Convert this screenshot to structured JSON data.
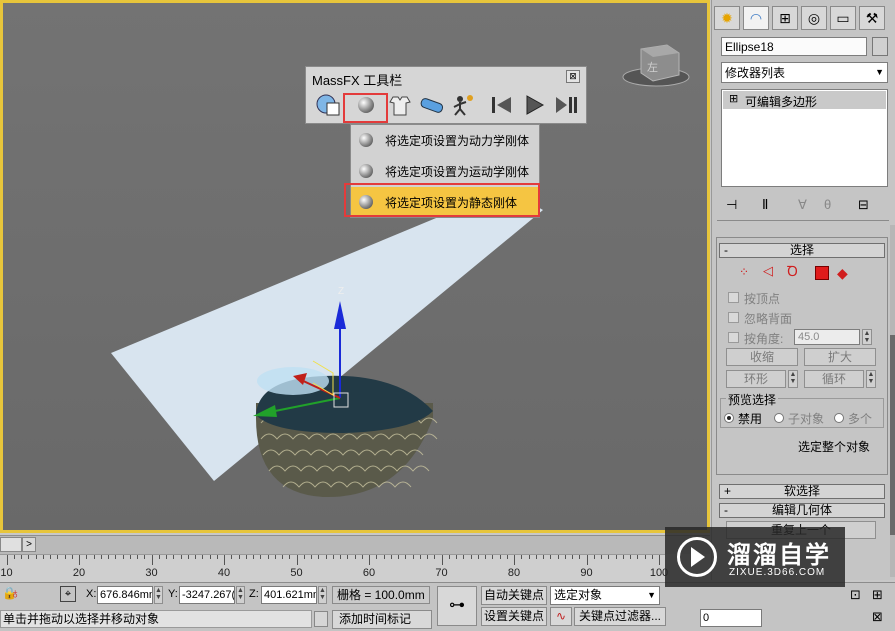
{
  "massfx_toolbar": {
    "title": "MassFX 工具栏",
    "close_symbol": "⊠",
    "dropdown_items": [
      {
        "label": "将选定项设置为动力学刚体",
        "highlighted": false
      },
      {
        "label": "将选定项设置为运动学刚体",
        "highlighted": false
      },
      {
        "label": "将选定项设置为静态刚体",
        "highlighted": true
      }
    ]
  },
  "viewport": {
    "axis_z": "Z",
    "viewcube_face": "左",
    "accent_border_color": "#e7c53b"
  },
  "command_panel": {
    "object_name": "Ellipse18",
    "modifier_list": "修改器列表",
    "stack_item": "可编辑多边形",
    "stack_item_toggle": "⊞",
    "selection_rollout": {
      "title": "选择",
      "sign": "-",
      "by_vertex": "按顶点",
      "ignore_backfacing": "忽略背面",
      "by_angle": "按角度:",
      "angle_value": "45.0",
      "shrink": "收缩",
      "grow": "扩大",
      "ring": "环形",
      "loop": "循环",
      "preview_selection": "预览选择",
      "disable": "禁用",
      "subobject": "子对象",
      "multi": "多个",
      "selection_status": "选定整个对象"
    },
    "soft_selection": {
      "title": "软选择",
      "sign": "+"
    },
    "edit_geometry": {
      "title": "编辑几何体",
      "sign": "-",
      "partial_button": "重复上一个"
    }
  },
  "timeline": {
    "ticks": [
      "10",
      "20",
      "30",
      "40",
      "50",
      "60",
      "70",
      "80",
      "90",
      "100"
    ],
    "arrow": ">"
  },
  "statusbar": {
    "x_label": "X:",
    "x_value": "676.846mm",
    "y_label": "Y:",
    "y_value": "-3247.267(",
    "z_label": "Z:",
    "z_value": "401.621mm",
    "grid": "栅格 = 100.0mm",
    "auto_key": "自动关键点",
    "set_key": "设置关键点",
    "selected_object": "选定对象",
    "key_filters": "关键点过滤器...",
    "frame_value": "0",
    "prompt": "单击并拖动以选择并移动对象",
    "add_time_tag": "添加时间标记"
  },
  "watermark": {
    "title": "溜溜自学",
    "url": "ZIXUE.3D66.COM"
  }
}
